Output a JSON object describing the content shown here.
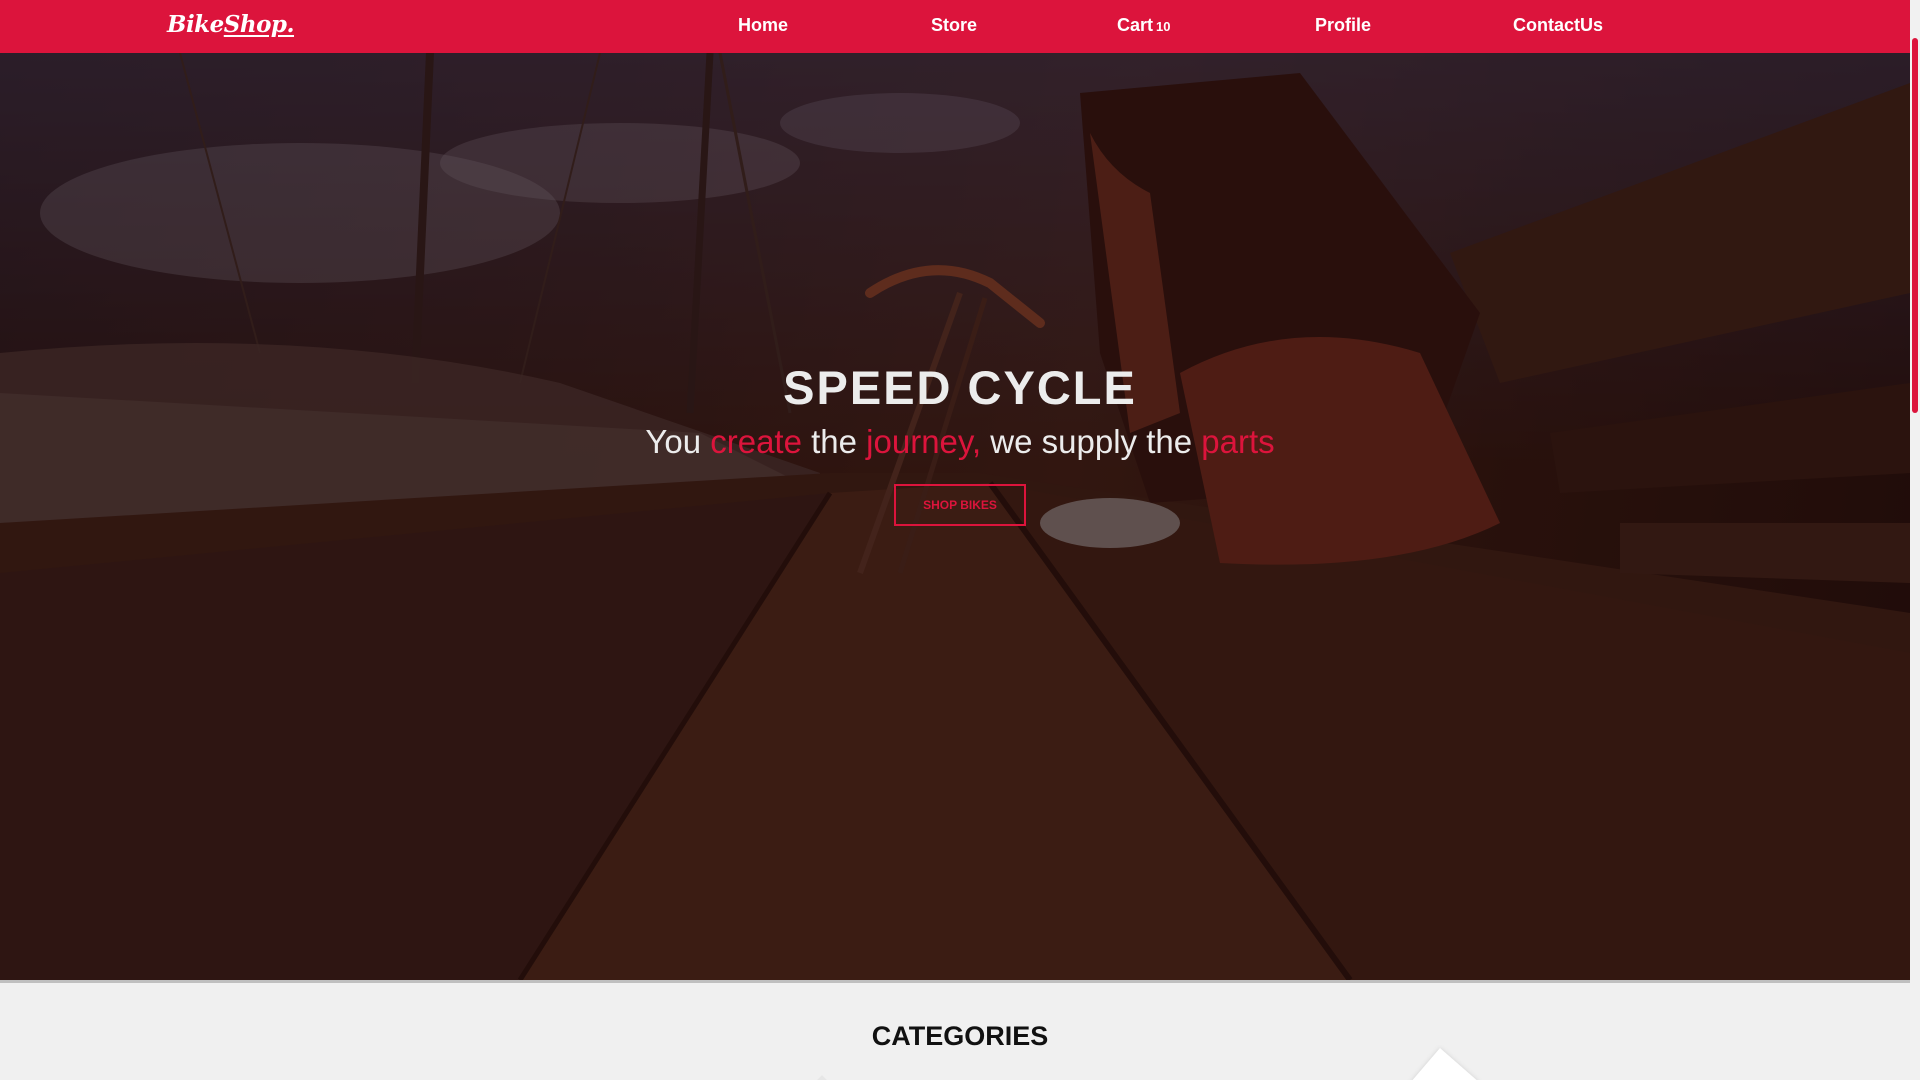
{
  "navbar": {
    "logo": {
      "part1": "Bike",
      "part2": "Shop."
    },
    "links": {
      "home": "Home",
      "store": "Store",
      "cart": "Cart",
      "cart_count": "10",
      "profile": "Profile",
      "contact": "ContactUs"
    },
    "background_color": "#dc143c"
  },
  "hero": {
    "title": "SPEED CYCLE",
    "tagline": {
      "w1": "You ",
      "w2": "create",
      "w3": " the ",
      "w4": "journey,",
      "w5": " we supply the ",
      "w6": "parts"
    },
    "button_label": "SHOP BIKES",
    "accent_color": "#dc143c"
  },
  "categories": {
    "title": "CATEGORIES"
  },
  "scrollbar": {
    "thumb_color": "#dc143c"
  }
}
